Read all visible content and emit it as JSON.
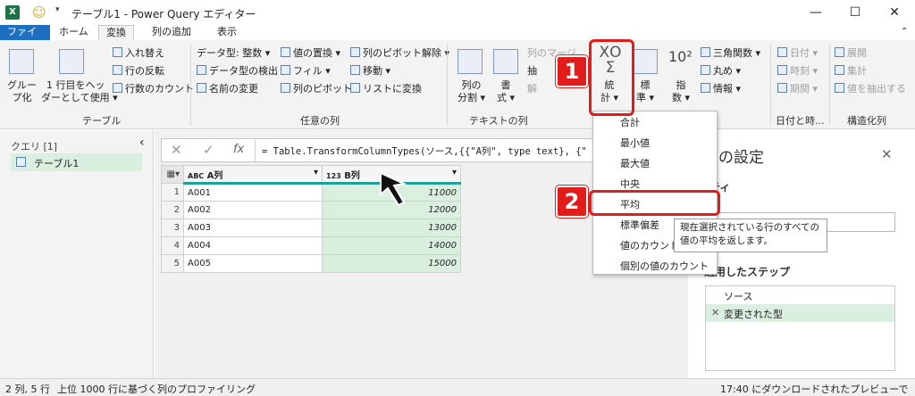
{
  "titlebar": {
    "app_icon": "X",
    "quick_access_icon": "smiley-icon",
    "title": "テーブル1 - Power Query エディター"
  },
  "tabs": [
    "ファイル",
    "ホーム",
    "変換",
    "列の追加",
    "表示"
  ],
  "ribbon": {
    "table_group": {
      "group_by": "グルー\nプ化",
      "first_row_header_1": "1 行目をヘッ",
      "first_row_header_2": "ダーとして使用 ▾",
      "transpose": "入れ替え",
      "reverse_rows": "行の反転",
      "count_rows": "行数のカウント",
      "label": "テーブル"
    },
    "any_column": {
      "data_type": "データ型: 整数 ▾",
      "detect_type": "データ型の検出",
      "rename": "名前の変更",
      "replace_values": "値の置換 ▾",
      "fill": "フィル ▾",
      "pivot": "列のピボット",
      "unpivot": "列のピボット解除 ▾",
      "move": "移動 ▾",
      "to_list": "リストに変換",
      "label": "任意の列"
    },
    "text_column": {
      "split": "列の\n分割 ▾",
      "format": "書\n式 ▾",
      "merge": "列のマージ",
      "extract": "抽",
      "parse": "解",
      "label": "テキストの列"
    },
    "number_column": {
      "statistics": "統\n計 ▾",
      "standard": "標\n準 ▾",
      "scientific": "指\n数 ▾",
      "trig": "三角関数 ▾",
      "rounding": "丸め ▾",
      "info": "情報 ▾"
    },
    "datetime": {
      "date": "日付 ▾",
      "time": "時刻 ▾",
      "duration": "期間 ▾",
      "label": "日付と時..."
    },
    "structured": {
      "expand": "展開",
      "aggregate": "集計",
      "extract_values": "値を抽出する",
      "label": "構造化列"
    }
  },
  "queries_panel": {
    "title": "クエリ [1]",
    "item": "テーブル1"
  },
  "formula_bar": {
    "formula": "= Table.TransformColumnTypes(ソース,{{\"A列\", type text}, {\""
  },
  "grid": {
    "columns": [
      {
        "type": "ABC",
        "name": "A列"
      },
      {
        "type": "123",
        "name": "B列"
      }
    ],
    "rows": [
      {
        "n": "1",
        "a": "A001",
        "b": "11000"
      },
      {
        "n": "2",
        "a": "A002",
        "b": "12000"
      },
      {
        "n": "3",
        "a": "A003",
        "b": "13000"
      },
      {
        "n": "4",
        "a": "A004",
        "b": "14000"
      },
      {
        "n": "5",
        "a": "A005",
        "b": "15000"
      }
    ]
  },
  "stats_menu": {
    "items": [
      "合計",
      "最小値",
      "最大値",
      "中央",
      "平均",
      "標準偏差",
      "値のカウント",
      "個別の値のカウント"
    ]
  },
  "tooltip": {
    "line1": "現在選択されている行のすべての",
    "line2": "値の平均を返します。"
  },
  "settings": {
    "title": "エリの設定",
    "properties": "ロパティ",
    "name_label": "前",
    "steps_title": "適用したステップ",
    "steps": [
      "ソース",
      "変更された型"
    ]
  },
  "status": {
    "left": "2 列, 5 行",
    "profiling": "上位 1000 行に基づく列のプロファイリング",
    "right": "17:40 にダウンロードされたプレビューです"
  },
  "annotations": {
    "badge1": "1",
    "badge2": "2"
  },
  "colors": {
    "accent": "#1e6fbf",
    "highlight": "#e21b1b",
    "excel": "#1f7244"
  }
}
